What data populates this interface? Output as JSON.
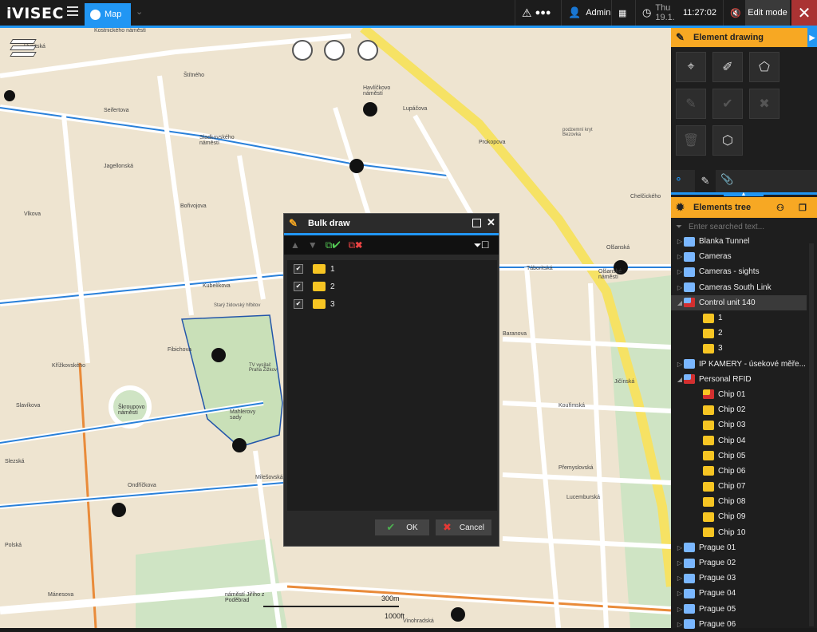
{
  "topbar": {
    "logo": "iVISEC",
    "map_tab": "Map",
    "user": "Admin",
    "date": "Thu 19.1.",
    "time": "11:27:02",
    "edit_mode": "Edit mode",
    "close_symbol": "✕"
  },
  "map": {
    "labels": [
      {
        "t": "Kostnického náměstí"
      },
      {
        "t": "Husitská"
      },
      {
        "t": "Štítného"
      },
      {
        "t": "Seifertova"
      },
      {
        "t": "Sladkovského náměstí"
      },
      {
        "t": "Havlíčkovo náměstí"
      },
      {
        "t": "Lupáčova"
      },
      {
        "t": "Prokopova"
      },
      {
        "t": "podzemní kryt Bezovka"
      },
      {
        "t": "Chelčického"
      },
      {
        "t": "Vlkova"
      },
      {
        "t": "Bořivojova"
      },
      {
        "t": "Kubelíkova"
      },
      {
        "t": "Táboritská"
      },
      {
        "t": "Olšanská"
      },
      {
        "t": "Olšanské náměstí"
      },
      {
        "t": "Jičínská"
      },
      {
        "t": "Křížkovského"
      },
      {
        "t": "Slavíkova"
      },
      {
        "t": "Škroupovo náměstí"
      },
      {
        "t": "Ondříčkova"
      },
      {
        "t": "Mahlerovy sady"
      },
      {
        "t": "TV vysílač Praha Žižkov"
      },
      {
        "t": "Starý židovský hřbitov"
      },
      {
        "t": "Baranova"
      },
      {
        "t": "Kouřimská"
      },
      {
        "t": "Přemyslovská"
      },
      {
        "t": "Lucemburská"
      },
      {
        "t": "Vinohradská"
      },
      {
        "t": "Mánesova"
      },
      {
        "t": "Polská"
      },
      {
        "t": "Slezská"
      },
      {
        "t": "náměstí Jiřího z Poděbrad"
      },
      {
        "t": "Milešovská"
      },
      {
        "t": "Fibichova"
      },
      {
        "t": "Jagellonská"
      }
    ],
    "scale_m": "300m",
    "scale_ft": "1000ft"
  },
  "element_drawing": {
    "title": "Element drawing"
  },
  "elements_tree": {
    "title": "Elements tree",
    "search_placeholder": "Enter searched text...",
    "items": [
      {
        "label": "Blanka Tunnel",
        "level": 0,
        "arrow": "▷",
        "icon": "camera-group"
      },
      {
        "label": "Cameras",
        "level": 0,
        "arrow": "▷",
        "icon": "camera-group"
      },
      {
        "label": "Cameras - sights",
        "level": 0,
        "arrow": "▷",
        "icon": "camera-group"
      },
      {
        "label": "Cameras South Link",
        "level": 0,
        "arrow": "▷",
        "icon": "camera-group"
      },
      {
        "label": "Control unit 140",
        "level": 0,
        "arrow": "◢",
        "icon": "control-unit-error",
        "selected": true
      },
      {
        "label": "1",
        "level": 1,
        "arrow": "",
        "icon": "sensor"
      },
      {
        "label": "2",
        "level": 1,
        "arrow": "",
        "icon": "sensor"
      },
      {
        "label": "3",
        "level": 1,
        "arrow": "",
        "icon": "sensor"
      },
      {
        "label": "IP KAMERY -  úsekové měře...",
        "level": 0,
        "arrow": "▷",
        "icon": "camera-group"
      },
      {
        "label": "Personal RFID",
        "level": 0,
        "arrow": "◢",
        "icon": "rfid-error"
      },
      {
        "label": "Chip 01",
        "level": 1,
        "arrow": "",
        "icon": "chip-error"
      },
      {
        "label": "Chip 02",
        "level": 1,
        "arrow": "",
        "icon": "chip"
      },
      {
        "label": "Chip 03",
        "level": 1,
        "arrow": "",
        "icon": "chip"
      },
      {
        "label": "Chip 04",
        "level": 1,
        "arrow": "",
        "icon": "chip"
      },
      {
        "label": "Chip 05",
        "level": 1,
        "arrow": "",
        "icon": "chip"
      },
      {
        "label": "Chip 06",
        "level": 1,
        "arrow": "",
        "icon": "chip"
      },
      {
        "label": "Chip 07",
        "level": 1,
        "arrow": "",
        "icon": "chip"
      },
      {
        "label": "Chip 08",
        "level": 1,
        "arrow": "",
        "icon": "chip"
      },
      {
        "label": "Chip 09",
        "level": 1,
        "arrow": "",
        "icon": "chip"
      },
      {
        "label": "Chip 10",
        "level": 1,
        "arrow": "",
        "icon": "chip"
      },
      {
        "label": "Prague 01",
        "level": 0,
        "arrow": "▷",
        "icon": "camera-group"
      },
      {
        "label": "Prague 02",
        "level": 0,
        "arrow": "▷",
        "icon": "camera-group"
      },
      {
        "label": "Prague 03",
        "level": 0,
        "arrow": "▷",
        "icon": "camera-group"
      },
      {
        "label": "Prague 04",
        "level": 0,
        "arrow": "▷",
        "icon": "camera-group"
      },
      {
        "label": "Prague 05",
        "level": 0,
        "arrow": "▷",
        "icon": "camera-group"
      },
      {
        "label": "Prague 06",
        "level": 0,
        "arrow": "▷",
        "icon": "camera-group"
      }
    ]
  },
  "bulk_draw": {
    "title": "Bulk draw",
    "rows": [
      {
        "label": "1",
        "checked": true
      },
      {
        "label": "2",
        "checked": true
      },
      {
        "label": "3",
        "checked": true
      }
    ],
    "ok_label": "OK",
    "cancel_label": "Cancel"
  },
  "colors": {
    "accent_blue": "#2196f3",
    "orange": "#f7a823",
    "close_red": "#a33"
  }
}
